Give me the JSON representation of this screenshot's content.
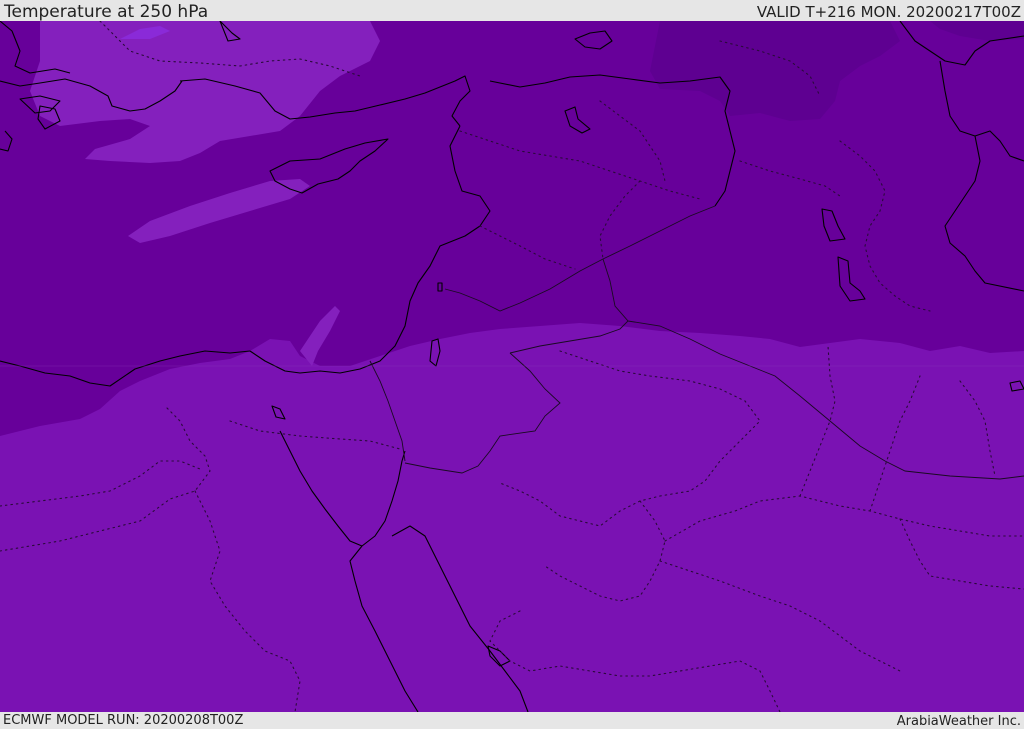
{
  "header": {
    "title": "Temperature at 250 hPa",
    "valid": "VALID T+216 MON. 20200217T00Z"
  },
  "footer": {
    "model_run": "ECMWF MODEL RUN: 20200208T00Z",
    "credit": "ArabiaWeather Inc."
  },
  "map": {
    "colors": {
      "cold_dark": "#5e0091",
      "cold": "#67009a",
      "mid": "#7a12b3",
      "patch_light": "#8420bd",
      "patch_violet": "#8a2ad8",
      "coast": "#000000",
      "border": "#1a0a22"
    }
  }
}
